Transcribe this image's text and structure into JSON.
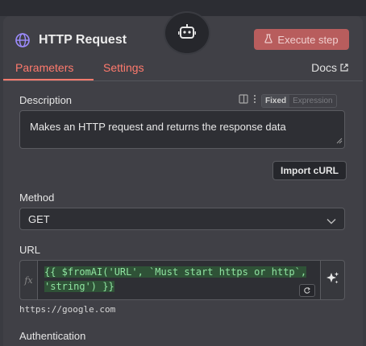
{
  "node": {
    "title": "HTTP Request",
    "execute_label": "Execute step",
    "icons": {
      "badge": "robot-icon",
      "title": "globe-icon",
      "execute": "flask-icon"
    }
  },
  "tabs": [
    {
      "label": "Parameters",
      "active": true
    },
    {
      "label": "Settings",
      "active": false
    }
  ],
  "docs_label": "Docs",
  "description": {
    "label": "Description",
    "mode_fixed": "Fixed",
    "mode_expression": "Expression",
    "value": "Makes an HTTP request and returns the response data"
  },
  "import_curl_label": "Import cURL",
  "method": {
    "label": "Method",
    "value": "GET"
  },
  "url": {
    "label": "URL",
    "fx_label": "fx",
    "expression_line1": "{{ $fromAI('URL', `Must start https or http`,",
    "expression_line2": "'string') }}",
    "resolved_value": "https://google.com"
  },
  "authentication_label": "Authentication",
  "colors": {
    "accent": "#ff7a6d",
    "execute_bg": "#b85d5d",
    "code_highlight": "#8fe3a0"
  }
}
